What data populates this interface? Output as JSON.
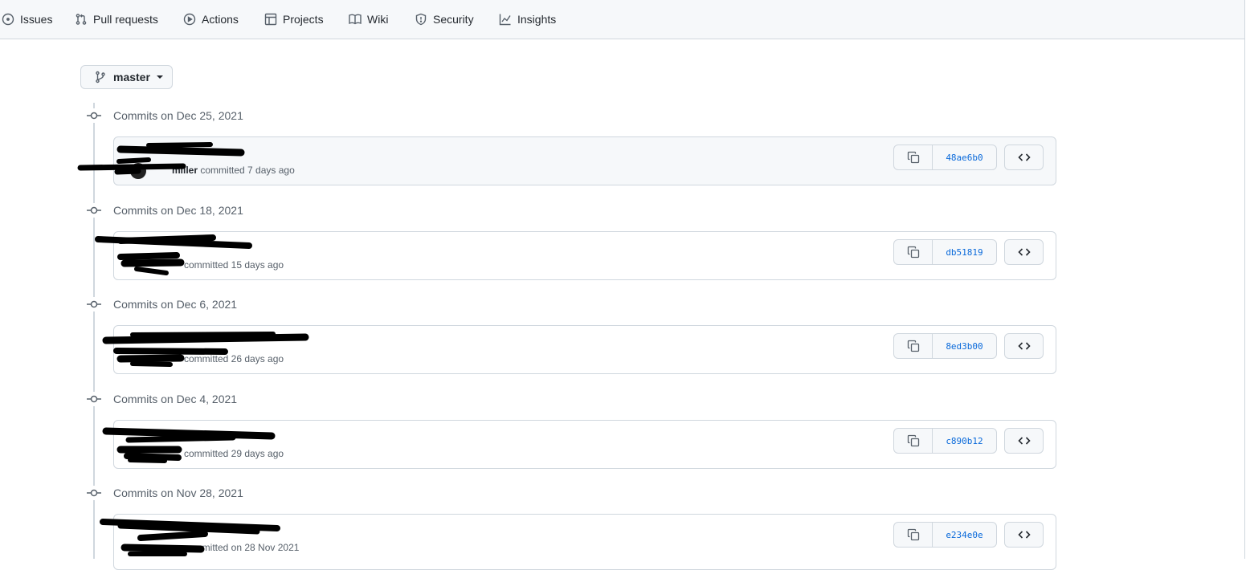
{
  "nav": {
    "tabs": [
      {
        "label": "Issues",
        "icon": "issue-opened-icon"
      },
      {
        "label": "Pull requests",
        "icon": "git-pull-request-icon"
      },
      {
        "label": "Actions",
        "icon": "play-icon"
      },
      {
        "label": "Projects",
        "icon": "table-icon"
      },
      {
        "label": "Wiki",
        "icon": "book-icon"
      },
      {
        "label": "Security",
        "icon": "shield-icon"
      },
      {
        "label": "Insights",
        "icon": "graph-icon"
      }
    ]
  },
  "branch": {
    "name": "master",
    "icon": "git-branch-icon"
  },
  "groups": [
    {
      "date_label": "Commits on Dec 25, 2021",
      "commit": {
        "author": "miller",
        "meta": "committed 7 days ago",
        "sha": "48ae6b0"
      }
    },
    {
      "date_label": "Commits on Dec 18, 2021",
      "commit": {
        "author": "",
        "meta": "committed 15 days ago",
        "sha": "db51819"
      }
    },
    {
      "date_label": "Commits on Dec 6, 2021",
      "commit": {
        "author": "",
        "meta": "committed 26 days ago",
        "sha": "8ed3b00"
      }
    },
    {
      "date_label": "Commits on Dec 4, 2021",
      "commit": {
        "author": "",
        "meta": "committed 29 days ago",
        "sha": "c890b12"
      }
    },
    {
      "date_label": "Commits on Nov 28, 2021",
      "commit": {
        "author": "",
        "meta": "committed on 28 Nov 2021",
        "sha": "e234e0e"
      }
    }
  ],
  "colors": {
    "link": "#0969da",
    "border": "#d0d7de",
    "muted": "#57606a",
    "redaction": "#000000"
  }
}
